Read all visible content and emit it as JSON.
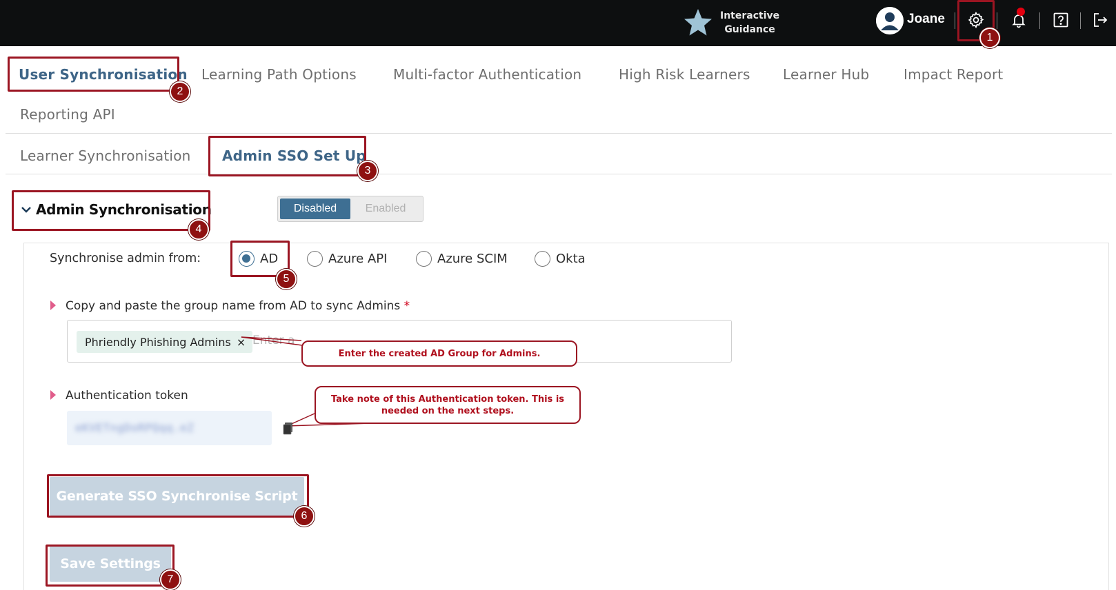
{
  "header": {
    "interactive_guidance_line1": "Interactive",
    "interactive_guidance_line2": "Guidance",
    "username": "Joane",
    "icons": [
      "star-icon",
      "user-avatar-icon",
      "gear-icon",
      "bell-icon",
      "help-icon",
      "logout-icon"
    ],
    "notification_dot_color": "#e3000f"
  },
  "tabs": [
    {
      "label": "User Synchronisation",
      "active": true
    },
    {
      "label": "Learning Path Options",
      "active": false
    },
    {
      "label": "Multi-factor Authentication",
      "active": false
    },
    {
      "label": "High Risk Learners",
      "active": false
    },
    {
      "label": "Learner Hub",
      "active": false
    },
    {
      "label": "Impact Report",
      "active": false
    },
    {
      "label": "Reporting API",
      "active": false
    }
  ],
  "subtabs": [
    {
      "label": "Learner Synchronisation",
      "active": false
    },
    {
      "label": "Admin SSO Set Up",
      "active": true
    }
  ],
  "section": {
    "title": "Admin Synchronisation",
    "toggle_disabled": "Disabled",
    "toggle_enabled": "Enabled",
    "toggle_selected": "Disabled"
  },
  "sync_from": {
    "label": "Synchronise admin from:",
    "options": [
      "AD",
      "Azure API",
      "Azure SCIM",
      "Okta"
    ],
    "selected": "AD"
  },
  "group": {
    "label": "Copy and paste the group name from AD to sync Admins",
    "required_mark": "*",
    "chip": "Phriendly Phishing Admins",
    "chip_remove": "×",
    "placeholder": "Enter a"
  },
  "token": {
    "label": "Authentication token",
    "value_obscured": "eKVETngDoRPQqq.eZ"
  },
  "buttons": {
    "generate": "Generate SSO Synchronise Script",
    "save": "Save Settings"
  },
  "annotations": {
    "callout_group": "Enter the created AD Group for Admins.",
    "callout_token": "Take note of this Authentication token. This is needed on the next steps.",
    "badges": [
      "1",
      "2",
      "3",
      "4",
      "5",
      "6",
      "7"
    ],
    "color": "#9b1522"
  },
  "colors": {
    "accent": "#3e6f93",
    "active_tab": "#3e6587",
    "topbar": "#0d0f10",
    "button_disabled": "#c6d4e0"
  }
}
